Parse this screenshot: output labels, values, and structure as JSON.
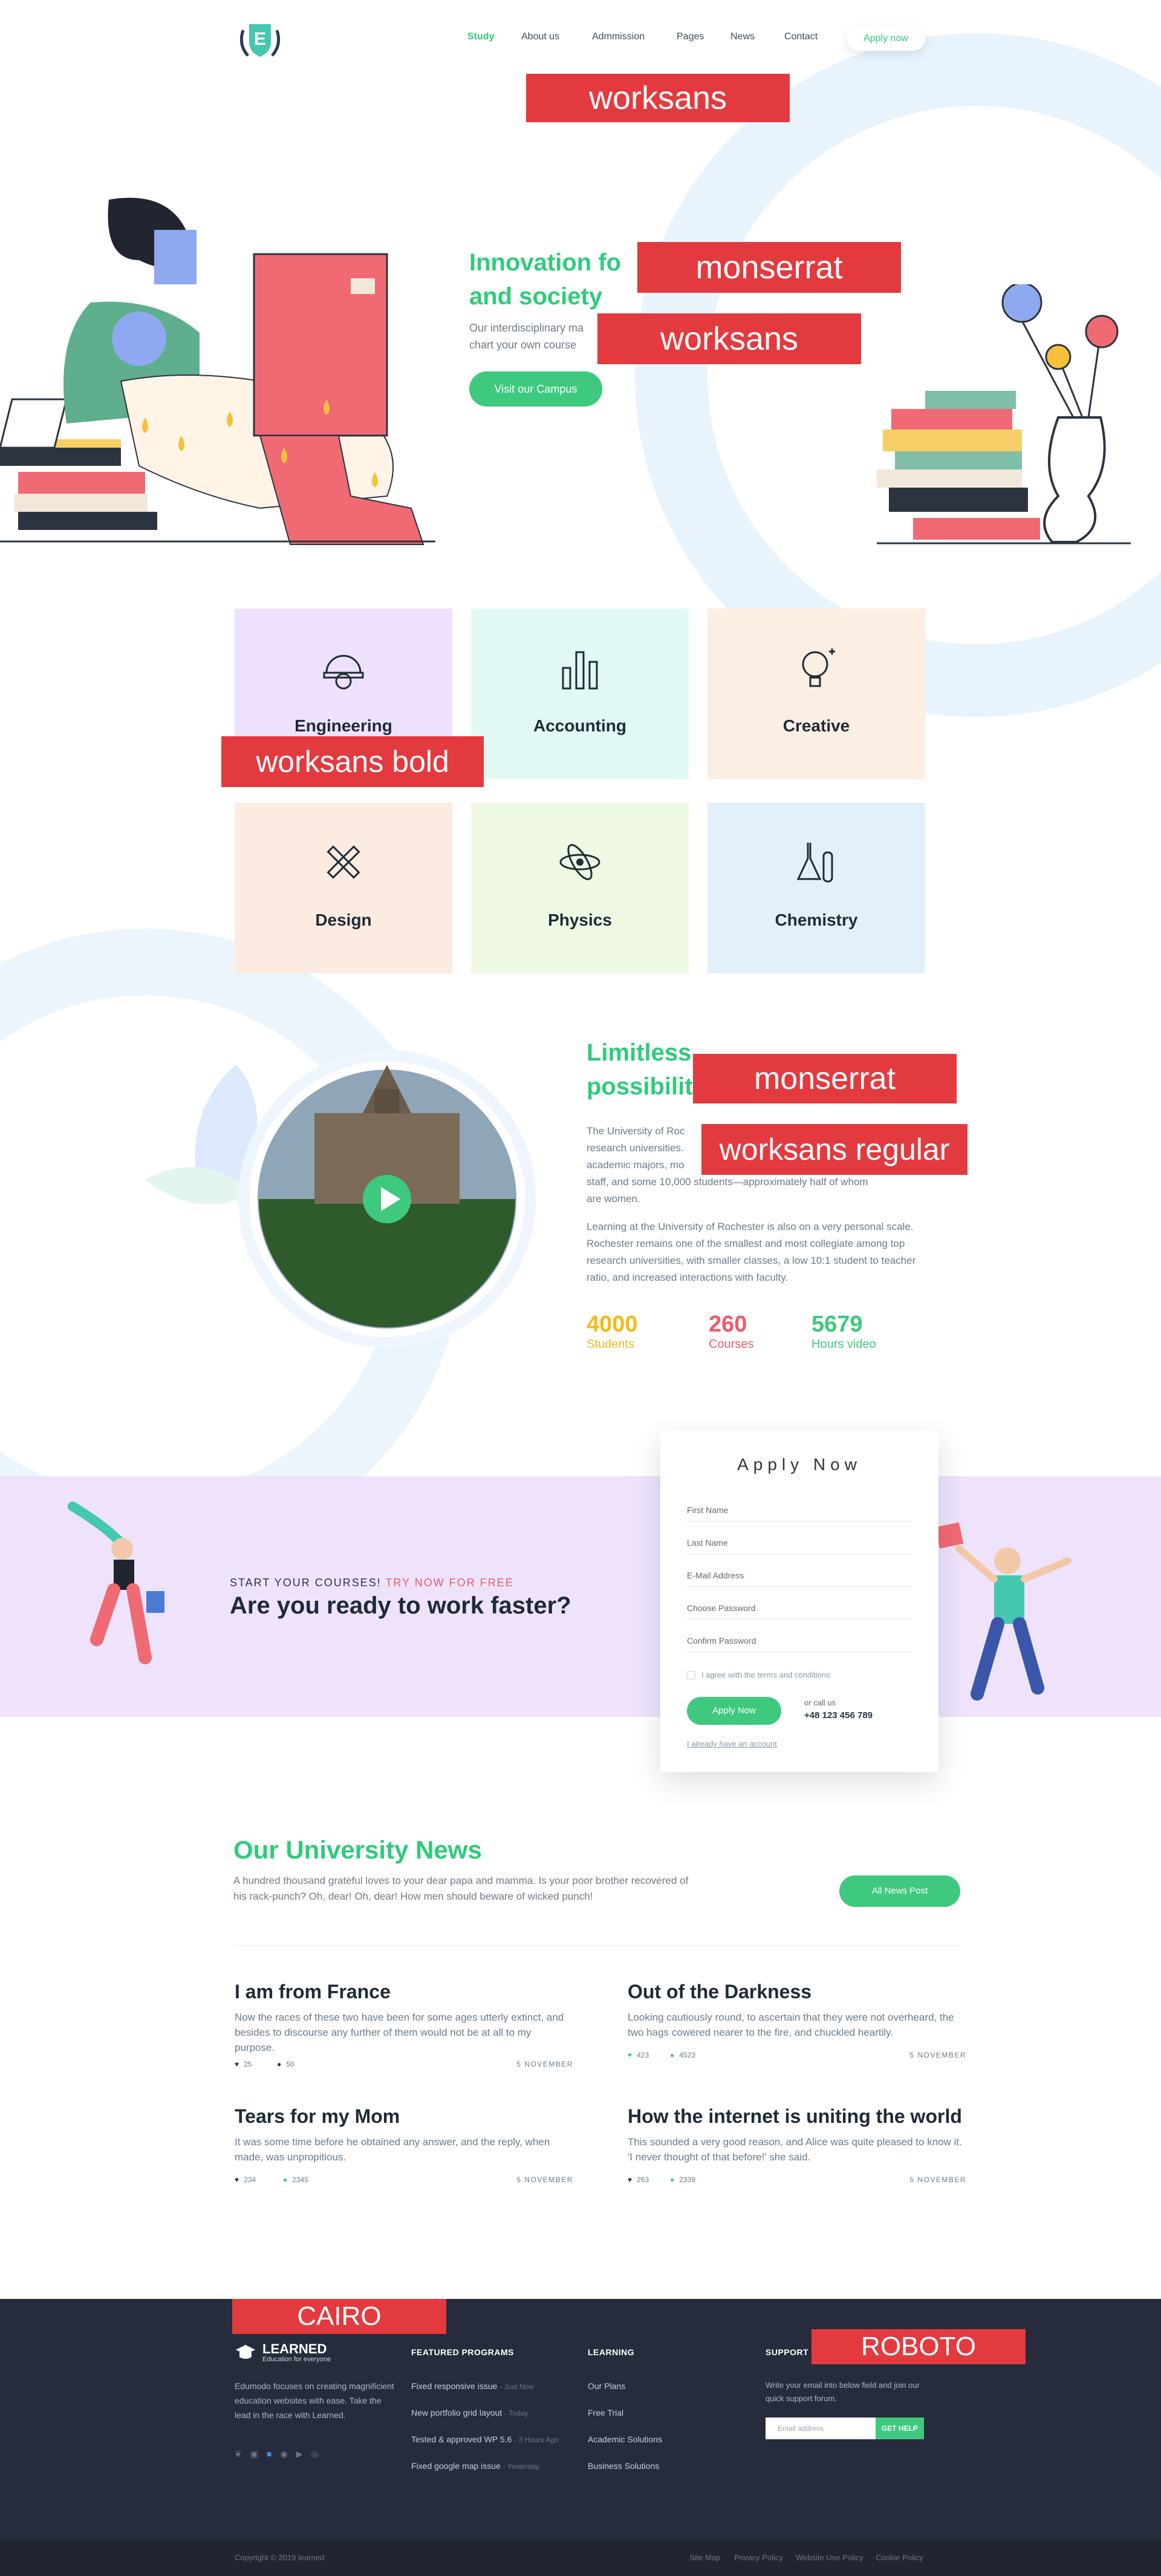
{
  "header": {
    "logo_letter": "E",
    "nav": [
      "Study",
      "About us",
      "Admmission",
      "Pages",
      "News",
      "Contact"
    ],
    "nav_active": "Study",
    "apply_label": "Apply now"
  },
  "font_tags": {
    "t1": "worksans",
    "t2": "monserrat",
    "t3": "worksans",
    "t4": "worksans bold",
    "t5": "monserrat",
    "t6": "worksans regular",
    "t7": "CAIRO",
    "t8": "ROBOTO"
  },
  "hero": {
    "title_line1": "Innovation fo",
    "title_line2": "and society",
    "subtitle_line1": "Our interdisciplinary ma",
    "subtitle_line2": "chart your own course",
    "button": "Visit our Campus"
  },
  "categories": [
    {
      "label": "Engineering",
      "icon": "helmet-gear-icon",
      "bg": "#ede1fb"
    },
    {
      "label": "Accounting",
      "icon": "bar-chart-icon",
      "bg": "#e2f8f4"
    },
    {
      "label": "Creative",
      "icon": "lightbulb-icon",
      "bg": "#fbeee2"
    },
    {
      "label": "Design",
      "icon": "ruler-pencil-icon",
      "bg": "#fbebe0"
    },
    {
      "label": "Physics",
      "icon": "atom-icon",
      "bg": "#eef8e2"
    },
    {
      "label": "Chemistry",
      "icon": "flask-icon",
      "bg": "#e2f0fa"
    }
  ],
  "about": {
    "title_line1": "Limitless",
    "title_line2": "possibilit",
    "p1_line1": "The University of Roc",
    "p1_line2": "research universities.",
    "p1_line3": "academic majors, mo",
    "p1_line4": "staff, and some 10,000 students—approximately half of whom",
    "p1_line5": "are women.",
    "p2": "Learning at the University of Rochester is also on a very personal scale. Rochester remains one of the smallest and most collegiate among top research universities, with smaller classes, a low 10:1 student to teacher ratio, and increased interactions with faculty.",
    "stats": [
      {
        "value": "4000",
        "label": "Students",
        "color": "#f6b91a"
      },
      {
        "value": "260",
        "label": "Courses",
        "color": "#f05a6a"
      },
      {
        "value": "5679",
        "label": "Hours video",
        "color": "#3ec97e"
      }
    ]
  },
  "cta": {
    "kicker": "START YOUR COURSES!",
    "kicker_accent": "TRY NOW FOR FREE",
    "title": "Are you ready to work faster?"
  },
  "apply_form": {
    "title": "Apply Now",
    "fields": [
      "First Name",
      "Last Name",
      "E-Mail Address",
      "Choose Password",
      "Confirm Password"
    ],
    "agree": "I agree with the terms and conditions",
    "button": "Apply Now",
    "call_label": "or call us",
    "phone": "+48 123 456 789",
    "have_account": "I already have an account"
  },
  "news": {
    "title": "Our University News",
    "intro": "A hundred thousand grateful loves to your dear papa and mamma. Is your poor brother recovered of his rack-punch? Oh, dear! Oh, dear! How men should beware of wicked punch!",
    "all_button": "All News Post",
    "posts": [
      {
        "title": "I am from France",
        "excerpt": "Now the races of these two have been for some ages utterly extinct, and besides to discourse any further of them would not be at all to my purpose.",
        "likes": "25",
        "comments": "50",
        "date": "5 NOVEMBER",
        "icon_color": "#2c3440"
      },
      {
        "title": "Out of the Darkness",
        "excerpt": "Looking cautiously round, to ascertain that they were not overheard, the two hags cowered nearer to the fire, and chuckled heartily.",
        "likes": "423",
        "comments": "4523",
        "date": "5 NOVEMBER",
        "icon_color": "#3ec97e"
      },
      {
        "title": "Tears for my Mom",
        "excerpt": "It was some time before he obtained any answer, and the reply, when made, was unpropitious.",
        "likes": "234",
        "comments": "2345",
        "date": "5 NOVEMBER",
        "icon_color": "#2c3440"
      },
      {
        "title": "How the internet is uniting the world",
        "excerpt": "This sounded a very good reason, and Alice was quite pleased to know it. 'I never thought of that before!' she said.",
        "likes": "263",
        "comments": "2339",
        "date": "5 NOVEMBER",
        "icon_color": "#2c3440"
      }
    ]
  },
  "footer": {
    "brand": "LEARNED",
    "brand_tag": "Education for everyone",
    "about": "Edumodo focuses on creating magnificient education websites with ease. Take the lead in the race with Learned.",
    "featured_head": "FEATURED PROGRAMS",
    "featured": [
      {
        "text": "Fixed responsive issue",
        "time": "Just Now"
      },
      {
        "text": "New portfolio grid layout",
        "time": "Today"
      },
      {
        "text": "Tested & approved WP 5.6",
        "time": "3 Hours Ago"
      },
      {
        "text": "Fixed google map issue",
        "time": "Yesterday"
      }
    ],
    "learning_head": "LEARNING",
    "learning": [
      "Our Plans",
      "Free Trial",
      "Academic Solutions",
      "Business Solutions"
    ],
    "support_head": "SUPPORT F",
    "support_text": "Write your email into below field and join our quick support forum.",
    "email_placeholder": "Email address",
    "help_button": "GET HELP",
    "social": [
      "twitter-icon",
      "instagram-icon",
      "facebook-icon",
      "pinterest-icon",
      "youtube-icon",
      "dribbble-icon"
    ],
    "copyright": "Copyright © 2019 learned",
    "bottom_links": [
      "Site Map",
      "Privacy Policy",
      "Website Use Policy",
      "Cookie Policy"
    ]
  }
}
